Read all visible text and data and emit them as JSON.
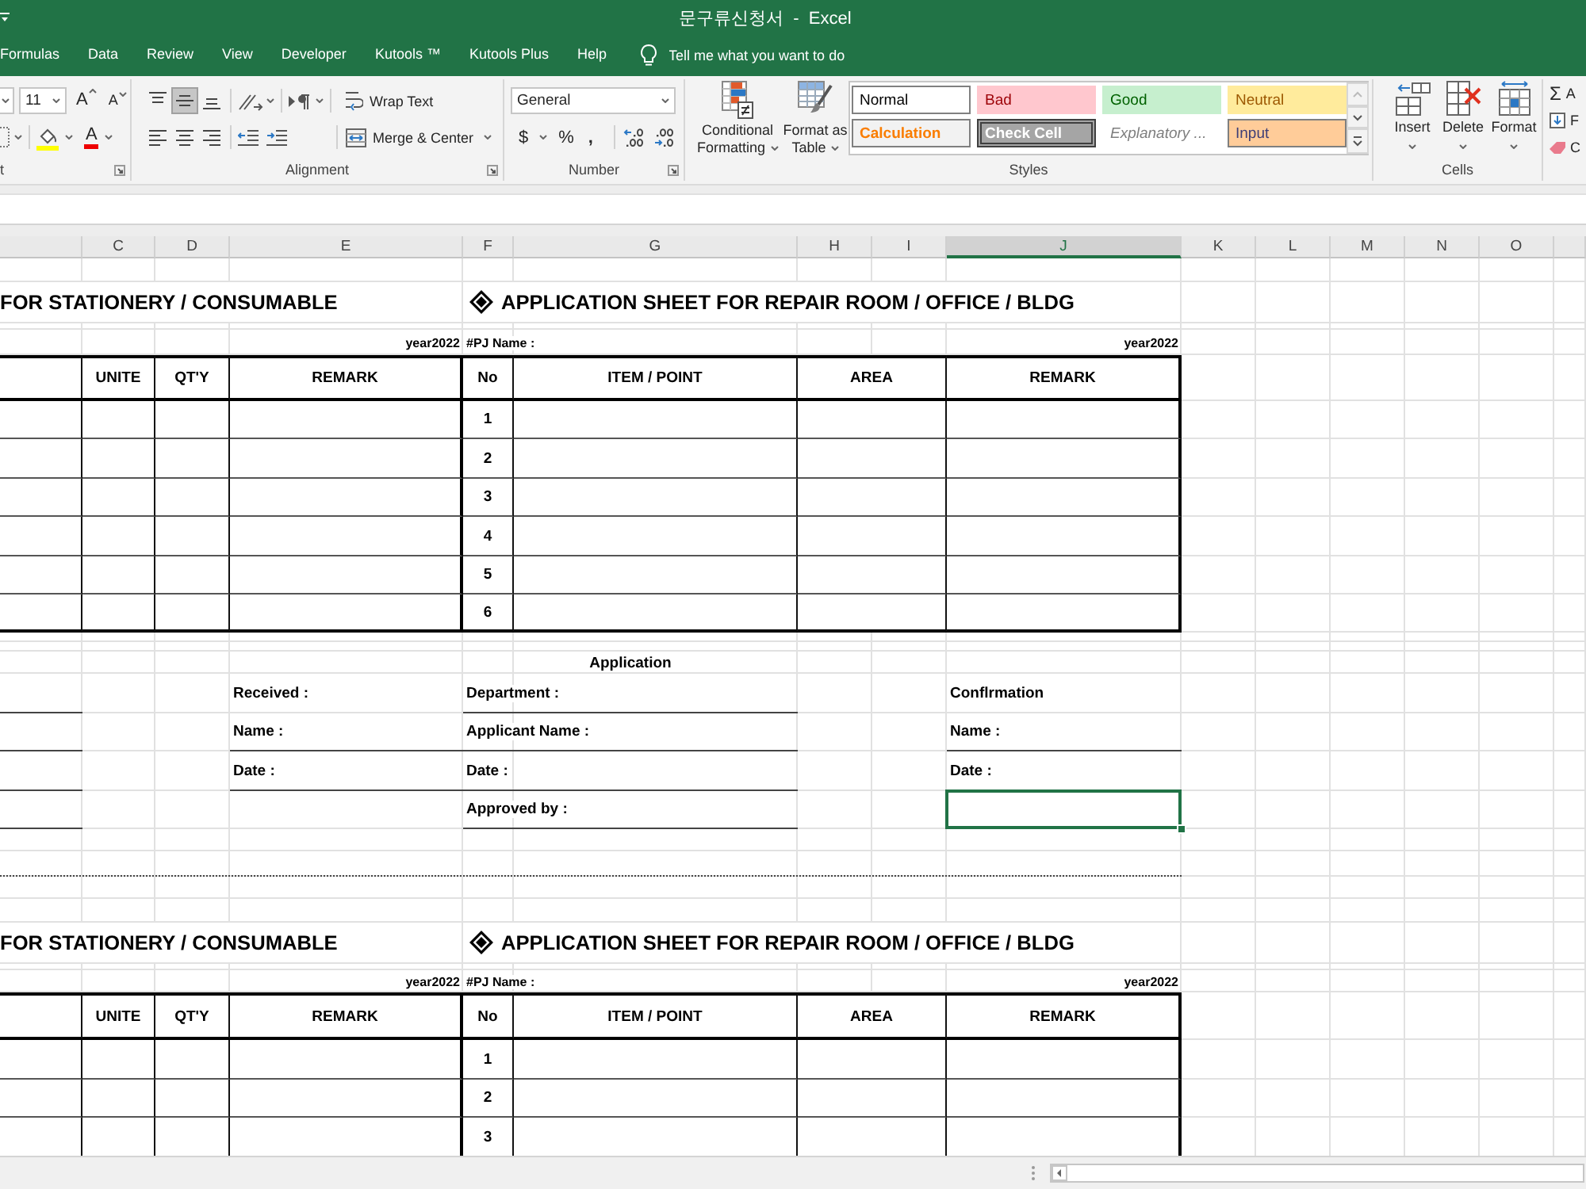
{
  "window": {
    "title": "문구류신청서  -  Excel"
  },
  "menu_tabs": [
    {
      "label": "Formulas",
      "selected": false
    },
    {
      "label": "Data",
      "selected": false
    },
    {
      "label": "Review",
      "selected": false
    },
    {
      "label": "View",
      "selected": false
    },
    {
      "label": "Developer",
      "selected": false
    },
    {
      "label": "Kutools ™",
      "selected": false
    },
    {
      "label": "Kutools Plus",
      "selected": false
    },
    {
      "label": "Help",
      "selected": false
    }
  ],
  "tell_me": {
    "placeholder": "Tell me what you want to do"
  },
  "ribbon": {
    "font": {
      "size": "11",
      "grow_font": "A",
      "shrink_font": "A",
      "font_color": "A",
      "label": "t"
    },
    "alignment": {
      "vertical_align": [
        {
          "kind": "top",
          "selected": false
        },
        {
          "kind": "middle",
          "selected": true
        },
        {
          "kind": "bottom",
          "selected": false
        }
      ],
      "horizontal_align": [
        {
          "kind": "left",
          "selected": false
        },
        {
          "kind": "center",
          "selected": false
        },
        {
          "kind": "right",
          "selected": false
        }
      ],
      "wrap_text": "Wrap Text",
      "merge_center": "Merge & Center",
      "label": "Alignment"
    },
    "number": {
      "format": "General",
      "currency": "$",
      "percent": "%",
      "comma": ",",
      "label": "Number"
    },
    "styles": {
      "conditional_formatting": "Conditional Formatting",
      "format_as_table": "Format as Table",
      "cell_styles": [
        {
          "label": "Normal",
          "kind": "normal"
        },
        {
          "label": "Bad",
          "kind": "bad"
        },
        {
          "label": "Good",
          "kind": "good"
        },
        {
          "label": "Neutral",
          "kind": "neutral"
        },
        {
          "label": "Calculation",
          "kind": "calculation"
        },
        {
          "label": "Check Cell",
          "kind": "check"
        },
        {
          "label": "Explanatory ...",
          "kind": "explanatory"
        },
        {
          "label": "Input",
          "kind": "input"
        }
      ],
      "label": "Styles"
    },
    "cells": {
      "buttons": [
        {
          "kind": "insert",
          "label": "Insert"
        },
        {
          "kind": "delete",
          "label": "Delete"
        },
        {
          "kind": "format",
          "label": "Format"
        }
      ],
      "label": "Cells"
    },
    "editing": {
      "items": [
        {
          "kind": "autosum",
          "symbol": "Σ",
          "label": "A"
        },
        {
          "kind": "fill",
          "label": "F"
        },
        {
          "kind": "clear",
          "label": "C"
        }
      ]
    }
  },
  "sheet": {
    "column_headers": [
      {
        "label": "C",
        "selected": false
      },
      {
        "label": "D",
        "selected": false
      },
      {
        "label": "E",
        "selected": false
      },
      {
        "label": "F",
        "selected": false
      },
      {
        "label": "G",
        "selected": false
      },
      {
        "label": "H",
        "selected": false
      },
      {
        "label": "I",
        "selected": false
      },
      {
        "label": "J",
        "selected": true
      },
      {
        "label": "K",
        "selected": false
      },
      {
        "label": "L",
        "selected": false
      },
      {
        "label": "M",
        "selected": false
      },
      {
        "label": "N",
        "selected": false
      },
      {
        "label": "O",
        "selected": false
      }
    ],
    "forms": [
      {
        "left_title": "FOR STATIONERY / CONSUMABLE",
        "right_title": "APPLICATION SHEET FOR REPAIR ROOM / OFFICE / BLDG",
        "left_year": "year2022",
        "pj_name": "#PJ Name :",
        "right_year": "year2022",
        "left_columns": [
          "UNITE",
          "QT'Y",
          "REMARK"
        ],
        "right_columns": [
          "No",
          "ITEM / POINT",
          "AREA",
          "REMARK"
        ],
        "row_numbers": [
          "1",
          "2",
          "3",
          "4",
          "5",
          "6"
        ],
        "approval": {
          "heading": "Application",
          "received": [
            "Received :",
            "Name :",
            "Date :"
          ],
          "applicant": [
            "Department :",
            "Applicant Name :",
            "Date :",
            "Approved by :"
          ],
          "confirmation": [
            "Conflrmation",
            "Name :",
            "Date :"
          ],
          "confirmation_cell": {
            "selected": true
          }
        }
      },
      {
        "left_title": "FOR STATIONERY / CONSUMABLE",
        "right_title": "APPLICATION SHEET FOR REPAIR ROOM / OFFICE / BLDG",
        "left_year": "year2022",
        "pj_name": "#PJ Name :",
        "right_year": "year2022",
        "left_columns": [
          "UNITE",
          "QT'Y",
          "REMARK"
        ],
        "right_columns": [
          "No",
          "ITEM / POINT",
          "AREA",
          "REMARK"
        ],
        "row_numbers": [
          "1",
          "2",
          "3"
        ]
      }
    ]
  }
}
